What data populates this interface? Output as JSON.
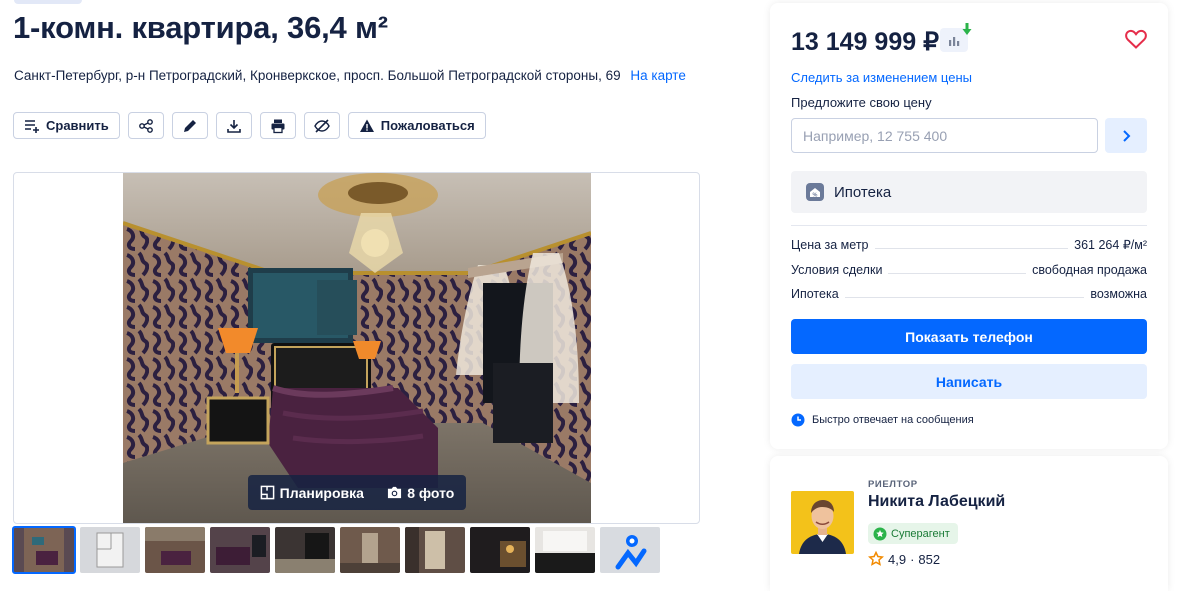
{
  "listing": {
    "title": "1-комн. квартира, 36,4 м²",
    "address": "Санкт-Петербург, р-н Петроградский, Кронверкское, просп. Большой Петроградской стороны, 69",
    "map_link": "На карте"
  },
  "toolbar": {
    "compare_label": "Сравнить",
    "report_label": "Пожаловаться",
    "icons": [
      "compare-icon",
      "share-icon",
      "pencil-icon",
      "download-icon",
      "print-icon",
      "hide-icon",
      "warning-icon"
    ]
  },
  "gallery": {
    "plan_label": "Планировка",
    "photos_label": "8 фото",
    "thumbnail_count": 10
  },
  "price_card": {
    "price": "13 149 999 ₽",
    "watch_link": "Следить за изменением цены",
    "offer_label": "Предложите свою цену",
    "offer_placeholder": "Например, 12 755 400",
    "mortgage_label": "Ипотека",
    "details": [
      {
        "label": "Цена за метр",
        "value": "361 264 ₽/м²"
      },
      {
        "label": "Условия сделки",
        "value": "свободная продажа"
      },
      {
        "label": "Ипотека",
        "value": "возможна"
      }
    ],
    "phone_button": "Показать телефон",
    "write_button": "Написать",
    "fast_reply": "Быстро отвечает на сообщения"
  },
  "realtor": {
    "role": "РИЕЛТОР",
    "name": "Никита Лабецкий",
    "badge": "Суперагент",
    "rating": "4,9",
    "reviews": "852"
  },
  "colors": {
    "accent": "#0468ff",
    "text": "#152242",
    "light_blue": "#e5efff",
    "green": "#2bb34a",
    "heart": "#e52d4a"
  }
}
